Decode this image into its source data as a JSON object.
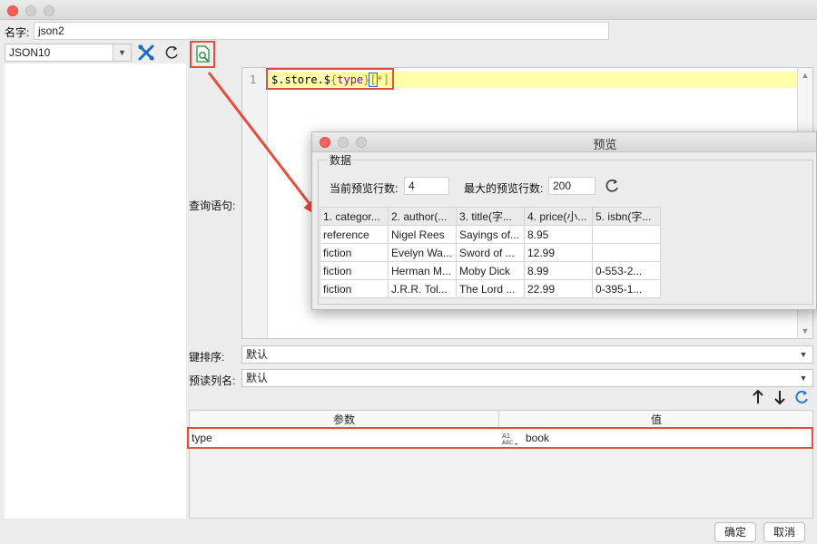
{
  "window": {},
  "name_field": {
    "label": "名字:",
    "value": "json2"
  },
  "datasource": {
    "selected": "JSON10"
  },
  "toolbar": {
    "icons": [
      "tools-icon",
      "refresh-icon",
      "preview-icon"
    ]
  },
  "query": {
    "label": "查询语句:",
    "line_number": "1",
    "code_parts": [
      "$.store.$",
      "{",
      "type",
      "}",
      "[",
      "*",
      "]"
    ]
  },
  "preview_dialog": {
    "title": "预览",
    "group_label": "数据",
    "current_rows_label": "当前预览行数:",
    "current_rows_value": "4",
    "max_rows_label": "最大的预览行数:",
    "max_rows_value": "200",
    "columns": [
      "1. categor...",
      "2. author(...",
      "3. title(字...",
      "4. price(小...",
      "5. isbn(字..."
    ],
    "rows": [
      [
        "reference",
        "Nigel Rees",
        "Sayings of...",
        "8.95",
        ""
      ],
      [
        "fiction",
        "Evelyn Wa...",
        "Sword of ...",
        "12.99",
        ""
      ],
      [
        "fiction",
        "Herman M...",
        "Moby Dick",
        "8.99",
        "0-553-2..."
      ],
      [
        "fiction",
        "J.R.R. Tol...",
        "The Lord ...",
        "22.99",
        "0-395-1..."
      ]
    ]
  },
  "key_sort": {
    "label": "键排序:",
    "value": "默认"
  },
  "preread_columns": {
    "label": "预读列名:",
    "value": "默认"
  },
  "params": {
    "header_param": "参数",
    "header_value": "值",
    "rows": [
      {
        "param": "type",
        "value": "book"
      }
    ]
  },
  "footer": {
    "ok": "确定",
    "cancel": "取消"
  },
  "colors": {
    "highlight": "#e74c3c",
    "current_line": "#ffffaa",
    "accent_blue": "#1f7fd8"
  }
}
